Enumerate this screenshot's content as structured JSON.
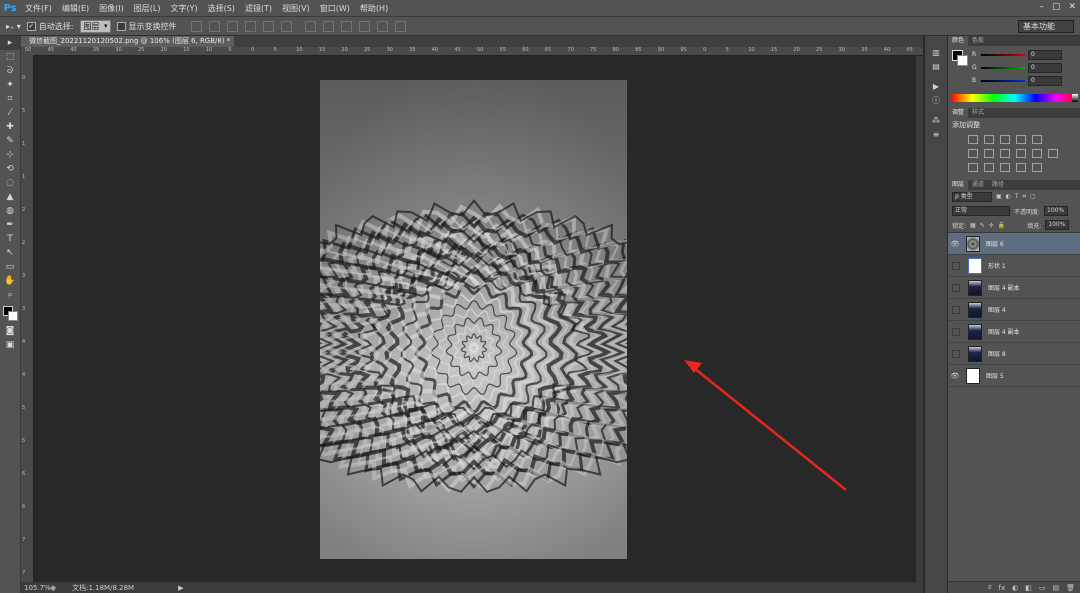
{
  "app": {
    "logo": "Ps"
  },
  "menu": [
    "文件(F)",
    "编辑(E)",
    "图像(I)",
    "图层(L)",
    "文字(Y)",
    "选择(S)",
    "滤镜(T)",
    "视图(V)",
    "窗口(W)",
    "帮助(H)"
  ],
  "window_controls": [
    "–",
    "▢",
    "✕"
  ],
  "options": {
    "auto_select_label": "自动选择:",
    "auto_select_value": "图层",
    "transform_label": "显示变换控件",
    "workspace": "基本功能"
  },
  "tools": [
    "▸",
    "⬚",
    "ᘐ",
    "✦",
    "⌗",
    "⁄",
    "✚",
    "✎",
    "⊹",
    "⟲",
    "◌",
    "▲",
    "◍",
    "✒",
    "T",
    "↖",
    "▭",
    "✋",
    "⌕"
  ],
  "document": {
    "tab_label": "微信截图_20221120120502.png @ 106% (图层 6, RGB/8) *",
    "ruler_top": [
      "50",
      "45",
      "40",
      "35",
      "30",
      "25",
      "20",
      "15",
      "10",
      "5",
      "0",
      "5",
      "10",
      "15",
      "20",
      "25",
      "30",
      "35",
      "40",
      "45",
      "50",
      "55",
      "60",
      "65",
      "70",
      "75",
      "80",
      "85",
      "90",
      "95",
      "0",
      "5",
      "10",
      "15",
      "20",
      "25",
      "30",
      "35",
      "40",
      "45"
    ],
    "ruler_left": [
      "0",
      "5",
      "1",
      "1",
      "2",
      "2",
      "3",
      "3",
      "4",
      "4",
      "5",
      "5",
      "6",
      "6",
      "7",
      "7"
    ],
    "zoom": "105.7%",
    "info": "文档:1.18M/8.28M"
  },
  "color_panel": {
    "tabs": [
      "颜色",
      "色板"
    ],
    "channels": [
      {
        "label": "R",
        "value": "0",
        "color": "#d40000"
      },
      {
        "label": "G",
        "value": "0",
        "color": "#00b000"
      },
      {
        "label": "B",
        "value": "0",
        "color": "#0030d0"
      }
    ]
  },
  "adjust_panel": {
    "tabs": [
      "调整",
      "样式"
    ],
    "title": "添加调整"
  },
  "layers_panel": {
    "tabs": [
      "图层",
      "通道",
      "路径"
    ],
    "filter": "ρ 类型",
    "blend": "正常",
    "opacity_label": "不透明度:",
    "opacity": "100%",
    "lock_label": "锁定:",
    "fill_label": "填充:",
    "fill": "100%",
    "layers": [
      {
        "name": "图层 6",
        "visible": true,
        "selected": true,
        "thumb": "ripple"
      },
      {
        "name": "形状 1",
        "visible": false,
        "selected": false,
        "thumb": "shape"
      },
      {
        "name": "图层 4 副本",
        "visible": false,
        "selected": false,
        "thumb": "figure"
      },
      {
        "name": "图层 4",
        "visible": false,
        "selected": false,
        "thumb": "figure"
      },
      {
        "name": "图层 4 副本",
        "visible": false,
        "selected": false,
        "thumb": "figure"
      },
      {
        "name": "图层 8",
        "visible": false,
        "selected": false,
        "thumb": "figure"
      },
      {
        "name": "图层 5",
        "visible": true,
        "selected": false,
        "thumb": "white"
      }
    ],
    "footer": [
      "ಠ",
      "fx",
      "◐",
      "◧",
      "▭",
      "▤",
      "🗑"
    ]
  },
  "colors": {
    "arrow": "#e8261c",
    "selected_layer": "#5f6d80"
  }
}
